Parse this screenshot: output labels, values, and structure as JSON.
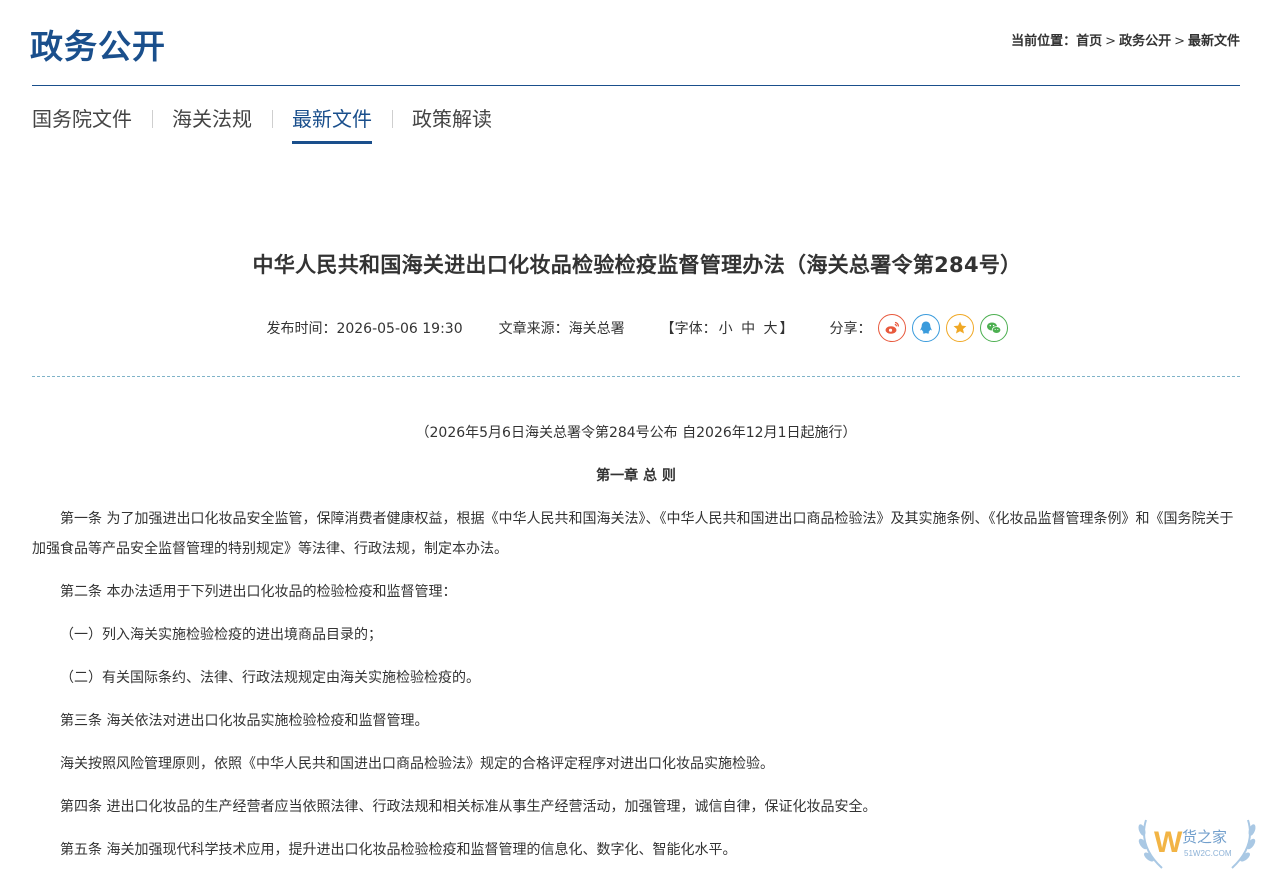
{
  "header": {
    "section_title": "政务公开",
    "breadcrumb": {
      "prefix": "当前位置：",
      "items": [
        "首页",
        "政务公开",
        "最新文件"
      ],
      "separator": ">"
    }
  },
  "tabs": [
    {
      "label": "国务院文件",
      "active": false
    },
    {
      "label": "海关法规",
      "active": false
    },
    {
      "label": "最新文件",
      "active": true
    },
    {
      "label": "政策解读",
      "active": false
    }
  ],
  "article": {
    "title": "中华人民共和国海关进出口化妆品检验检疫监督管理办法（海关总署令第284号）",
    "meta": {
      "publish_time": "发布时间：2026-05-06 19:30",
      "source": "文章来源：海关总署",
      "font_size_prefix": "【字体：",
      "font_small": "小",
      "font_medium": "中",
      "font_large": "大",
      "font_size_suffix": "】",
      "share_label": "分享："
    },
    "share_icons": [
      "weibo-icon",
      "qq-icon",
      "qzone-star-icon",
      "wechat-icon"
    ],
    "paragraphs": {
      "p0": "（2026年5月6日海关总署令第284号公布 自2026年12月1日起施行）",
      "p1": "第一章 总 则",
      "p2": "第一条 为了加强进出口化妆品安全监管，保障消费者健康权益，根据《中华人民共和国海关法》、《中华人民共和国进出口商品检验法》及其实施条例、《化妆品监督管理条例》和《国务院关于加强食品等产品安全监督管理的特别规定》等法律、行政法规，制定本办法。",
      "p3": "第二条 本办法适用于下列进出口化妆品的检验检疫和监督管理：",
      "p4": "（一）列入海关实施检验检疫的进出境商品目录的；",
      "p5": "（二）有关国际条约、法律、行政法规规定由海关实施检验检疫的。",
      "p6": "第三条 海关依法对进出口化妆品实施检验检疫和监督管理。",
      "p7": "海关按照风险管理原则，依照《中华人民共和国进出口商品检验法》规定的合格评定程序对进出口化妆品实施检验。",
      "p8": "第四条 进出口化妆品的生产经营者应当依照法律、行政法规和相关标准从事生产经营活动，加强管理，诚信自律，保证化妆品安全。",
      "p9": "第五条 海关加强现代科学技术应用，提升进出口化妆品检验检疫和监督管理的信息化、数字化、智能化水平。"
    }
  },
  "watermark": {
    "brand": "货之家",
    "domain": "51W2C.COM",
    "letter": "W"
  },
  "colors": {
    "brand_blue": "#1a4f8c",
    "text": "#333333",
    "dash_rule": "#7fb3c8",
    "weibo": "#e8593d",
    "qq": "#3a9bdc",
    "star": "#f0a825",
    "wechat": "#4caf50"
  }
}
